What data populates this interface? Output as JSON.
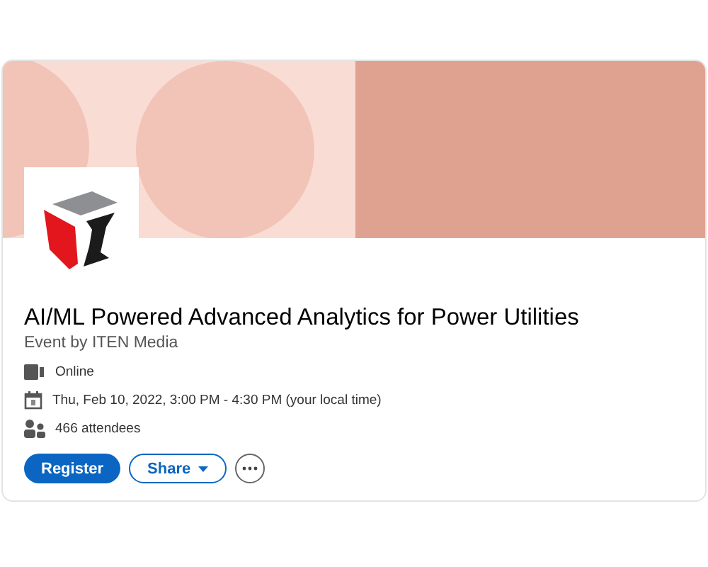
{
  "event": {
    "title": "AI/ML Powered Advanced Analytics for Power Utilities",
    "organizer": "Event by ITEN Media",
    "details": [
      {
        "kind": "video",
        "text": "Online"
      },
      {
        "kind": "calendar",
        "text": "Thu, Feb 10, 2022, 3:00 PM - 4:30 PM (your local time)"
      },
      {
        "kind": "people",
        "text": "466 attendees"
      }
    ],
    "buttons": [
      {
        "kind": "primary",
        "label": "Register"
      },
      {
        "kind": "dropdown",
        "label": "Share"
      },
      {
        "kind": "more"
      }
    ]
  }
}
